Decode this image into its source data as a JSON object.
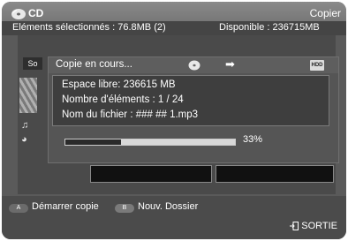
{
  "header": {
    "title": "CD",
    "action": "Copier"
  },
  "selection": {
    "selected": "Eléments sélectionnés : 76.8MB  (2)",
    "available": "Disponible : 236715MB"
  },
  "background": {
    "tab_label": "So"
  },
  "dialog": {
    "title": "Copie en cours...",
    "dest_badge": "HDD",
    "lines": [
      "Espace libre: 236615 MB",
      "Nombre d'éléments :  1 / 24",
      "Nom du fichier : ### ## 1.mp3"
    ],
    "progress": {
      "percent": 33,
      "label": "33%"
    }
  },
  "footer": {
    "btn_a": "A",
    "btn_a_label": "Démarrer copie",
    "btn_b": "B",
    "btn_b_label": "Nouv. Dossier",
    "exit_label": "SORTIE"
  },
  "icons": {
    "disc": "disc-icon",
    "arrow": "arrow-right-icon",
    "hdd": "hdd-icon",
    "music": "music-note-icon",
    "exit": "exit-icon"
  }
}
